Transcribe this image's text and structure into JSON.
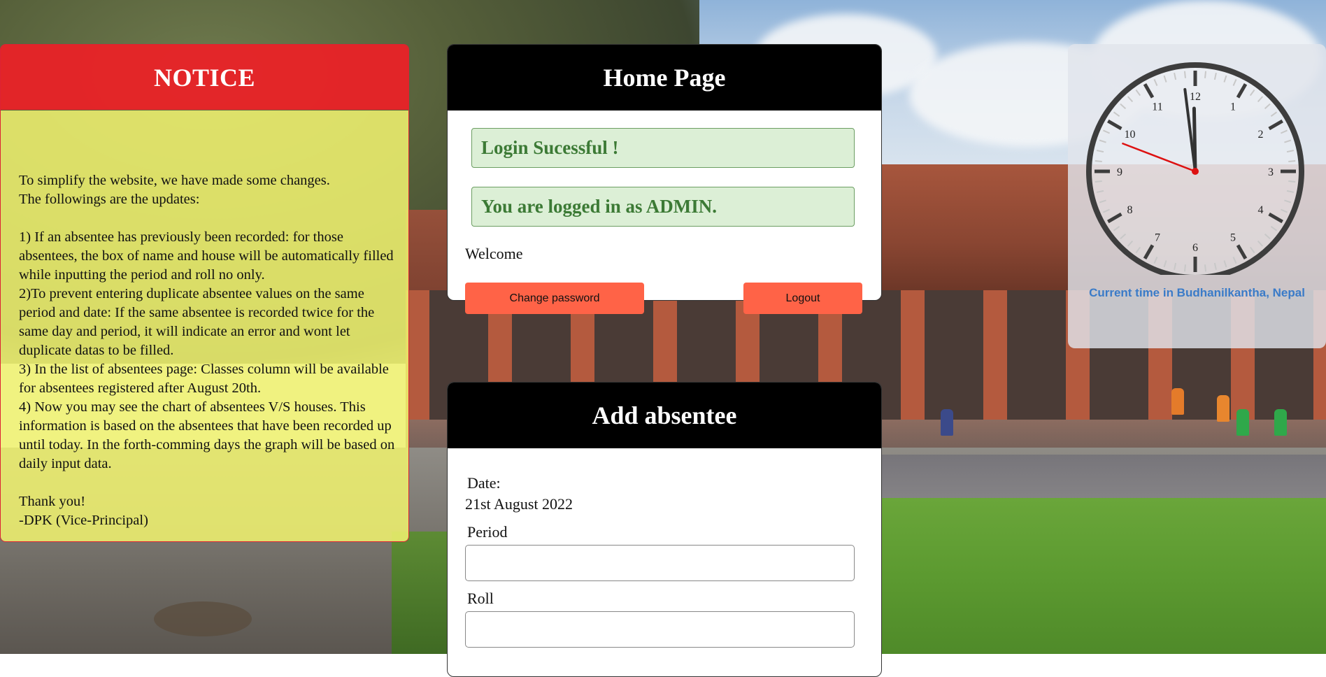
{
  "notice": {
    "title": "NOTICE",
    "body": "To simplify the website, we have made some changes.\nThe followings are the updates:\n\n1) If an absentee has previously been recorded: for those absentees, the box of name and house will be automatically filled while inputting the period and roll no only.\n2)To prevent entering duplicate absentee values on the same period and date: If the same absentee is recorded twice for the same day and period, it will indicate an error and wont let duplicate datas to be filled.\n3) In the list of absentees page: Classes column will be available for absentees registered after August 20th.\n4) Now you may see the chart of absentees V/S houses. This information is based on the absentees that have been recorded up until today. In the forth-comming days the graph will be based on daily input data.\n\nThank you!\n-DPK (Vice-Principal)"
  },
  "home": {
    "title": "Home Page",
    "alert_login": "Login Sucessful !",
    "alert_admin": "You are logged in as ADMIN.",
    "welcome": "Welcome",
    "change_password_label": "Change password",
    "logout_label": "Logout"
  },
  "absentee_form": {
    "title": "Add absentee",
    "date_label": "Date:",
    "date_value": "21st August 2022",
    "period_label": "Period",
    "period_value": "",
    "roll_label": "Roll",
    "roll_value": ""
  },
  "clock": {
    "caption": "Current time in Budhanilkantha, Nepal",
    "numbers": [
      "12",
      "1",
      "2",
      "3",
      "4",
      "5",
      "6",
      "7",
      "8",
      "9",
      "10",
      "11"
    ],
    "hour": 11,
    "minute": 58,
    "second": 48.5
  }
}
